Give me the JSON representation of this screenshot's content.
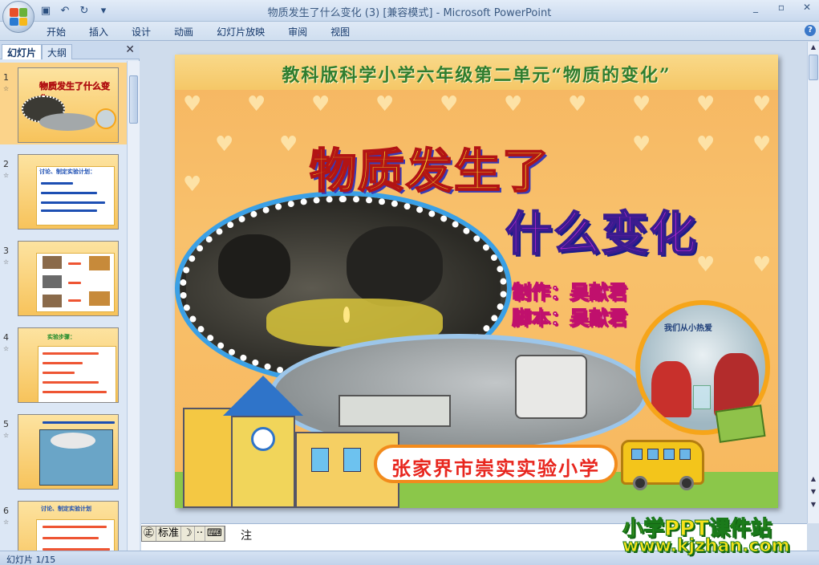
{
  "window": {
    "title": "物质发生了什么变化 (3) [兼容模式] - Microsoft PowerPoint",
    "controls": [
      "_",
      "▫",
      "✕"
    ]
  },
  "quick_access": {
    "save_icon": "save-icon",
    "undo_icon": "undo-icon",
    "redo_icon": "redo-icon"
  },
  "ribbon": {
    "tabs": [
      "开始",
      "插入",
      "设计",
      "动画",
      "幻灯片放映",
      "审阅",
      "视图"
    ],
    "help_label": "?"
  },
  "left_pane": {
    "tab_slides": "幻灯片",
    "tab_outline": "大纲",
    "close_label": "✕",
    "slides": [
      {
        "number": "1",
        "title": "物质发生了什么变化"
      },
      {
        "number": "2",
        "title": "讨论、制定实验计划："
      },
      {
        "number": "3",
        "title": ""
      },
      {
        "number": "4",
        "title": "实验步骤："
      },
      {
        "number": "5",
        "title": ""
      },
      {
        "number": "6",
        "title": "讨论、制定实验计划"
      }
    ]
  },
  "slide": {
    "banner": "教科版科学小学六年级第二单元“物质的变化”",
    "title_line1": "物质发生了",
    "title_line2": "什么变化",
    "credit_author": "制作：吴献君",
    "credit_script": "脚本：吴献君",
    "school_name": "张家界市崇实实验小学",
    "photo_sign": "我们从小热爱"
  },
  "notes": {
    "ime_mode": "标准",
    "text": "注"
  },
  "status": {
    "slide_counter": "幻灯片 1/15"
  },
  "watermark": {
    "line1": "小学PPT课件站",
    "line2": "www.kjzhan.com"
  },
  "colors": {
    "accent": "#3a78c9",
    "selected_slide": "#fbd38a",
    "banner_green": "#2f7d2f"
  }
}
